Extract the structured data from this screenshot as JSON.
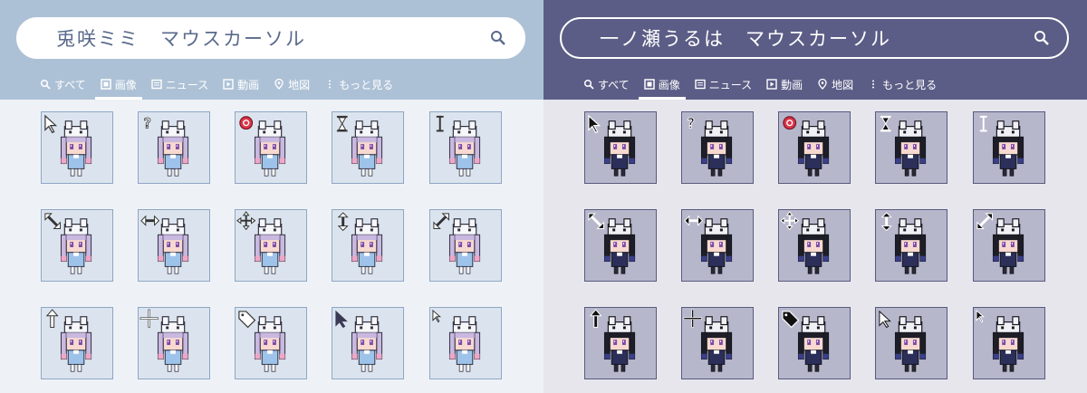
{
  "panels": [
    {
      "id": "left",
      "search_query": "兎咲ミミ　マウスカーソル",
      "tabs": [
        {
          "icon": "search-icon",
          "label": "すべて",
          "active": false
        },
        {
          "icon": "image-icon",
          "label": "画像",
          "active": true
        },
        {
          "icon": "news-icon",
          "label": "ニュース",
          "active": false
        },
        {
          "icon": "video-icon",
          "label": "動画",
          "active": false
        },
        {
          "icon": "map-pin-icon",
          "label": "地図",
          "active": false
        },
        {
          "icon": "more-vert-icon",
          "label": "もっと見る",
          "active": false
        }
      ],
      "cursors": [
        "arrow-cursor",
        "help-cursor",
        "busy-cursor",
        "hourglass-cursor",
        "text-cursor",
        "diagonal-resize-cursor",
        "horizontal-resize-cursor",
        "move-cursor",
        "vertical-resize-cursor",
        "diagonal-resize-alt-cursor",
        "up-arrow-cursor",
        "crosshair-cursor",
        "tag-cursor",
        "pointer-cursor",
        "working-cursor"
      ],
      "colors": {
        "header": "#adc1d6",
        "tile": "#dbe4ee",
        "hair": "#c9b8e0",
        "hair_tip": "#f0a6c8",
        "hat": "#f7f7fa",
        "dress": "#9ec3ea"
      }
    },
    {
      "id": "right",
      "search_query": "一ノ瀬うるは　マウスカーソル",
      "tabs": [
        {
          "icon": "search-icon",
          "label": "すべて",
          "active": false
        },
        {
          "icon": "image-icon",
          "label": "画像",
          "active": true
        },
        {
          "icon": "news-icon",
          "label": "ニュース",
          "active": false
        },
        {
          "icon": "video-icon",
          "label": "動画",
          "active": false
        },
        {
          "icon": "map-pin-icon",
          "label": "地図",
          "active": false
        },
        {
          "icon": "more-vert-icon",
          "label": "もっと見る",
          "active": false
        }
      ],
      "cursors": [
        "arrow-cursor",
        "help-cursor",
        "busy-cursor",
        "hourglass-cursor",
        "text-cursor",
        "diagonal-resize-cursor",
        "horizontal-resize-cursor",
        "move-cursor",
        "vertical-resize-cursor",
        "diagonal-resize-alt-cursor",
        "up-arrow-cursor",
        "crosshair-cursor",
        "tag-cursor",
        "pointer-cursor",
        "working-cursor"
      ],
      "colors": {
        "header": "#5c5d86",
        "tile": "#b7b7cc",
        "hair": "#1e1e28",
        "hair_tip": "#3a3f8a",
        "hat": "#f0f0f5",
        "dress": "#2b2f5a"
      }
    }
  ]
}
